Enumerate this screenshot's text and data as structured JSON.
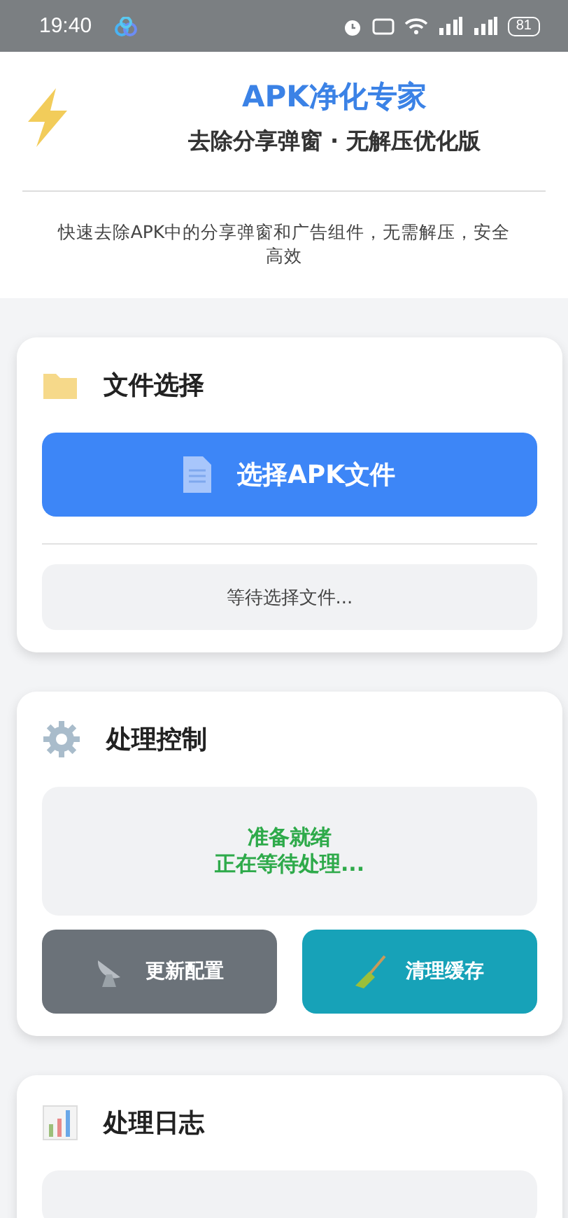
{
  "status_bar": {
    "time": "19:40",
    "battery": "81"
  },
  "header": {
    "title": "APK净化专家",
    "subtitle": "去除分享弹窗 · 无解压优化版",
    "description": "快速去除APK中的分享弹窗和广告组件，无需解压，安全高效"
  },
  "sections": [
    {
      "kind": "file",
      "title": "文件选择",
      "button": "选择APK文件",
      "status": "等待选择文件..."
    },
    {
      "kind": "control",
      "title": "处理控制",
      "status_lines": [
        "准备就绪",
        "正在等待处理..."
      ],
      "buttons": [
        {
          "label": "更新配置",
          "kind": "update"
        },
        {
          "label": "清理缓存",
          "kind": "clean"
        }
      ]
    },
    {
      "kind": "log",
      "title": "处理日志"
    }
  ]
}
